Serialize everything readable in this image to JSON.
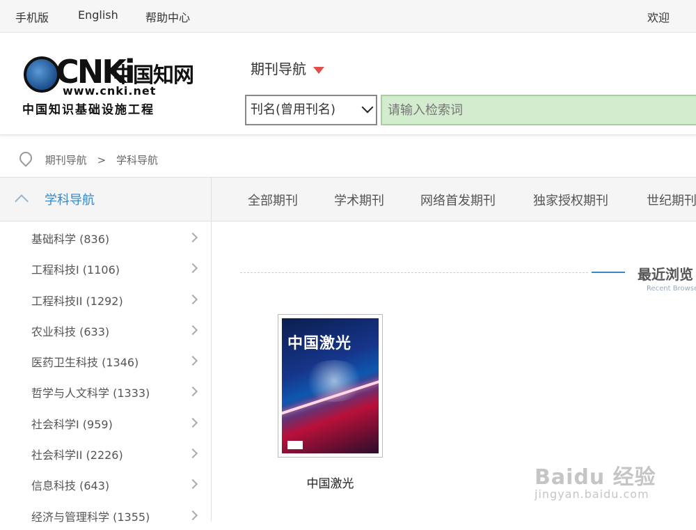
{
  "topbar": {
    "links": [
      "手机版",
      "English",
      "帮助中心"
    ],
    "welcome": "欢迎"
  },
  "logo": {
    "brand": "CNKi",
    "brand_cn": "中国知网",
    "url": "www.cnki.net",
    "tagline": "中国知识基础设施工程"
  },
  "header": {
    "nav_title": "期刊导航"
  },
  "search": {
    "field_select": "刊名(曾用刊名)",
    "placeholder": "请输入检索词"
  },
  "breadcrumb": {
    "items": [
      "期刊导航",
      "学科导航"
    ],
    "separator": ">"
  },
  "sidebar": {
    "title": "学科导航",
    "items": [
      {
        "label": "基础科学 (836)"
      },
      {
        "label": "工程科技I (1106)"
      },
      {
        "label": "工程科技II (1292)"
      },
      {
        "label": "农业科技 (633)"
      },
      {
        "label": "医药卫生科技 (1346)"
      },
      {
        "label": "哲学与人文科学 (1333)"
      },
      {
        "label": "社会科学I (959)"
      },
      {
        "label": "社会科学II (2226)"
      },
      {
        "label": "信息科技 (643)"
      },
      {
        "label": "经济与管理科学 (1355)"
      }
    ]
  },
  "tabs": [
    "全部期刊",
    "学术期刊",
    "网络首发期刊",
    "独家授权期刊",
    "世纪期刊"
  ],
  "recent": {
    "title": "最近浏览",
    "subtitle": "Recent Browse",
    "items": [
      {
        "title": "中国激光",
        "cover_title": "中国激光"
      }
    ]
  },
  "watermark": {
    "line1": "Baidu 经验",
    "line2": "jingyan.baidu.com"
  },
  "colors": {
    "accent": "#3a87c8",
    "search_bg": "#d3ecce",
    "dropdown_triangle": "#e0504a"
  }
}
